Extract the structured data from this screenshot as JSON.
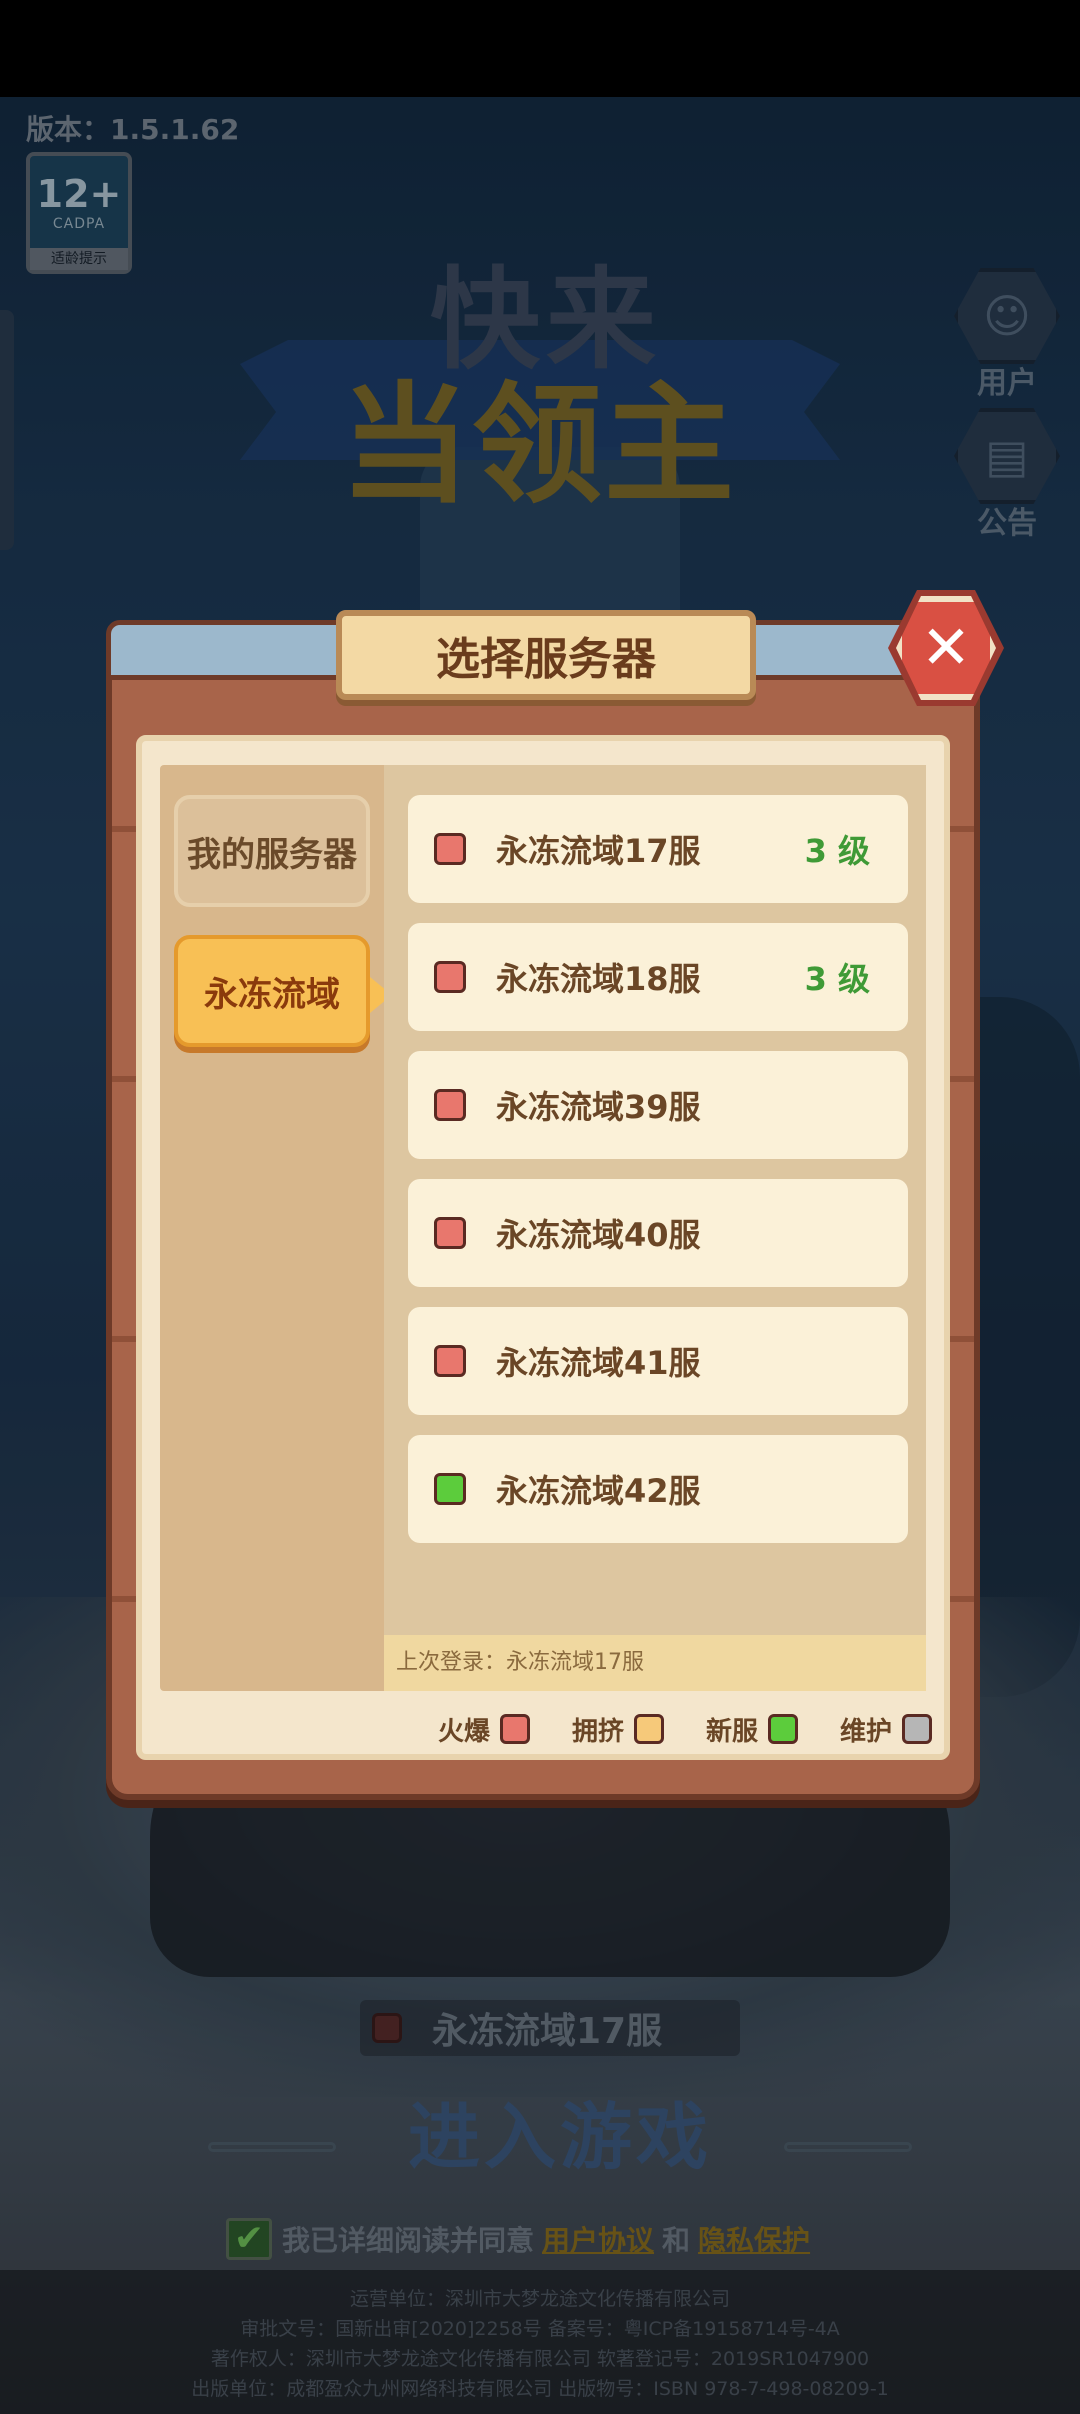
{
  "version": "版本：1.5.1.62",
  "age_rating": {
    "number": "12+",
    "org": "CADPA",
    "label": "适龄提示"
  },
  "logo": {
    "line1": "快来",
    "line2": "当领主"
  },
  "side_buttons": {
    "user": "用户",
    "notice": "公告"
  },
  "dialog": {
    "title": "选择服务器",
    "close_icon": "✕",
    "tabs": {
      "my_servers": "我的服务器",
      "active_region": "永冻流域"
    },
    "servers": [
      {
        "name": "永冻流域17服",
        "level": "3 级",
        "status": "hot",
        "color": "#e8776d"
      },
      {
        "name": "永冻流域18服",
        "level": "3 级",
        "status": "hot",
        "color": "#e8776d"
      },
      {
        "name": "永冻流域39服",
        "level": "",
        "status": "hot",
        "color": "#e8776d"
      },
      {
        "name": "永冻流域40服",
        "level": "",
        "status": "hot",
        "color": "#e8776d"
      },
      {
        "name": "永冻流域41服",
        "level": "",
        "status": "hot",
        "color": "#e8776d"
      },
      {
        "name": "永冻流域42服",
        "level": "",
        "status": "new",
        "color": "#5ccc3c"
      }
    ],
    "last_login": "上次登录：永冻流域17服",
    "legend": [
      {
        "label": "火爆",
        "color": "#e8776d"
      },
      {
        "label": "拥挤",
        "color": "#f6c97a"
      },
      {
        "label": "新服",
        "color": "#5ccc3c"
      },
      {
        "label": "维护",
        "color": "#b6b6b6"
      }
    ]
  },
  "current_server": "永冻流域17服",
  "enter_button": "进入游戏",
  "agreement": {
    "checkbox": "✔",
    "prefix": "我已详细阅读并同意",
    "link1": "用户协议",
    "and": "和",
    "link2": "隐私保护"
  },
  "footer": {
    "line1": "运营单位：深圳市大梦龙途文化传播有限公司",
    "line2": "审批文号：国新出审[2020]2258号 备案号：粤ICP备19158714号-4A",
    "line3": "著作权人：深圳市大梦龙途文化传播有限公司 软著登记号：2019SR1047900",
    "line4": "出版单位：成都盈众九州网络科技有限公司 出版物号：ISBN 978-7-498-08209-1"
  }
}
